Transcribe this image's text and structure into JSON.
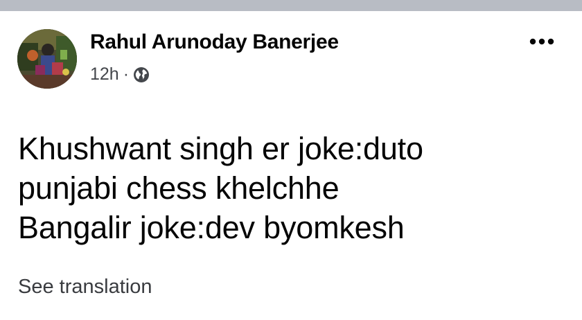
{
  "post": {
    "author_name": "Rahul Arunoday Banerjee",
    "timestamp": "12h",
    "separator": "·",
    "audience_icon": "globe-icon",
    "more_icon": "more-horizontal-icon",
    "text_lines": [
      "Khushwant singh er joke:duto",
      "punjabi chess khelchhe",
      "Bangalir joke:dev byomkesh"
    ],
    "see_translation": "See translation"
  },
  "colors": {
    "top_bar": "#b8bcc4",
    "text_primary": "#050505",
    "text_secondary": "#65676b",
    "background": "#ffffff"
  }
}
